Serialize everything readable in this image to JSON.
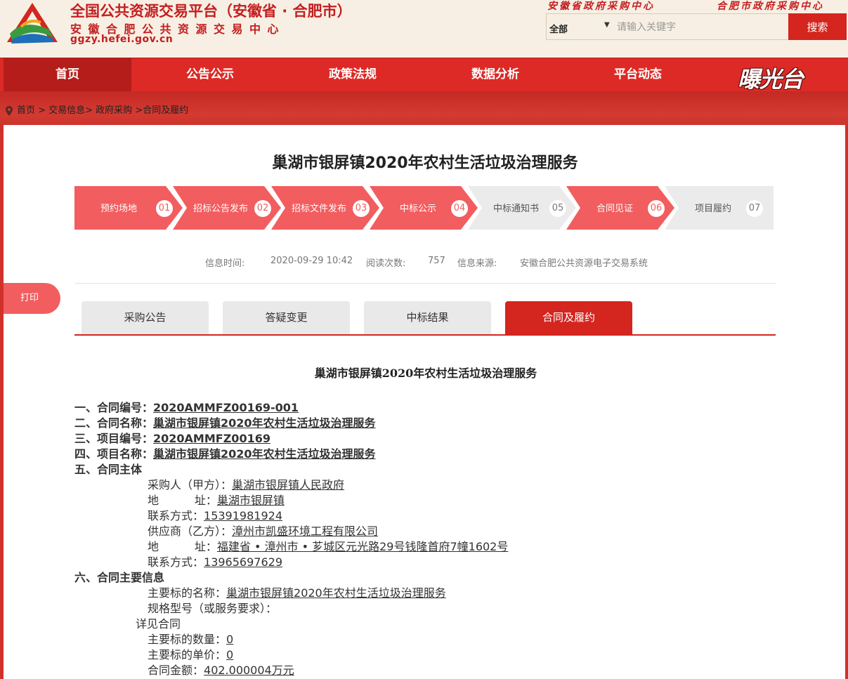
{
  "header": {
    "title": "全国公共资源交易平台（安徽省 · 合肥市）",
    "subtitle": "安徽合肥公共资源交易中心",
    "domain": "ggzy.hefei.gov.cn",
    "top_links": [
      "安徽省政府采购中心",
      "合肥市政府采购中心"
    ],
    "search": {
      "scope": "全部",
      "placeholder": "请输入关键字",
      "button": "搜索"
    }
  },
  "nav": {
    "items": [
      "首页",
      "公告公示",
      "政策法规",
      "数据分析",
      "平台动态"
    ],
    "active": "首页",
    "brand": "曝光台"
  },
  "breadcrumb": "首页 > 交易信息> 政府采购 >合同及履约",
  "page": {
    "title": "巢湖市银屏镇2020年农村生活垃圾治理服务",
    "steps": [
      {
        "label": "预约场地",
        "num": "01",
        "done": true
      },
      {
        "label": "招标公告发布",
        "num": "02",
        "done": true
      },
      {
        "label": "招标文件发布",
        "num": "03",
        "done": true
      },
      {
        "label": "中标公示",
        "num": "04",
        "done": true
      },
      {
        "label": "中标通知书",
        "num": "05",
        "done": false
      },
      {
        "label": "合同见证",
        "num": "06",
        "done": true
      },
      {
        "label": "项目履约",
        "num": "07",
        "done": false
      }
    ],
    "meta": {
      "time_label": "信息时间:",
      "time": "2020-09-29 10:42",
      "views_label": "阅读次数:",
      "views": "757",
      "source_label": "信息来源:",
      "source": "安徽合肥公共资源电子交易系统"
    },
    "print_label": "打印",
    "tabs": [
      "采购公告",
      "答疑变更",
      "中标结果",
      "合同及履约"
    ],
    "active_tab": "合同及履约"
  },
  "doc": {
    "title": "巢湖市银屏镇2020年农村生活垃圾治理服务",
    "contract_no_label": "一、合同编号：",
    "contract_no": "2020AMMFZ00169-001",
    "contract_name_label": "二、合同名称：",
    "contract_name": "巢湖市银屏镇2020年农村生活垃圾治理服务",
    "project_no_label": "三、项目编号：",
    "project_no": "2020AMMFZ00169",
    "project_name_label": "四、项目名称：",
    "project_name": "巢湖市银屏镇2020年农村生活垃圾治理服务",
    "parties_label": "五、合同主体",
    "buyer_label": "采购人（甲方）：",
    "buyer": "巢湖市银屏镇人民政府",
    "buyer_addr_label": "地          址：",
    "buyer_addr": "巢湖市银屏镇",
    "buyer_contact_label": "联系方式：",
    "buyer_contact": "15391981924",
    "supplier_label": "供应商（乙方）：",
    "supplier": "漳州市凯盛环境工程有限公司",
    "supplier_addr_label": "地          址：",
    "supplier_addr": "福建省 • 漳州市 • 芗城区元光路29号钱隆首府7幢1602号",
    "supplier_contact_label": "联系方式：",
    "supplier_contact": "13965697629",
    "main_info_label": "六、合同主要信息",
    "subject_name_label": "主要标的名称：",
    "subject_name": "巢湖市银屏镇2020年农村生活垃圾治理服务",
    "spec_label": "规格型号（或服务要求）：",
    "see_contract": "详见合同",
    "qty_label": "主要标的数量：",
    "qty": "0",
    "price_label": "主要标的单价：",
    "price": "0",
    "amount_label": "合同金额：",
    "amount": "402.000004万元"
  },
  "colors": {
    "brand_red": "#d4251f",
    "step_done": "#f25d5f",
    "step_pending": "#ebebeb",
    "header_bg": "#f7efe3"
  }
}
